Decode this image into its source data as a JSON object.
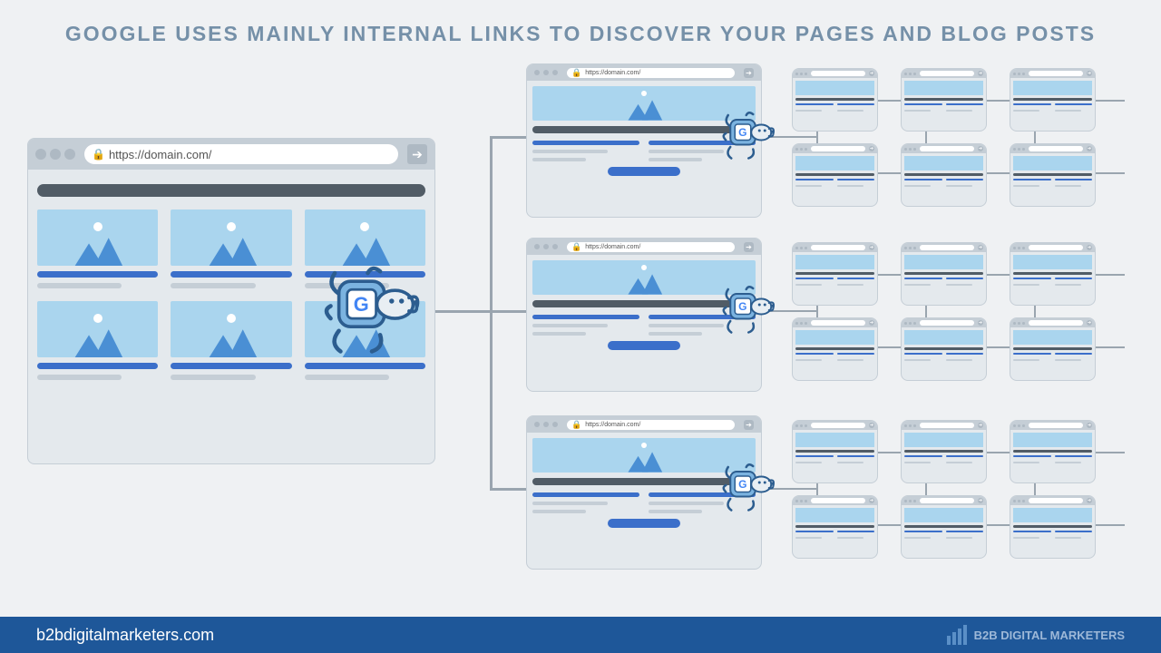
{
  "title": "GOOGLE USES MAINLY INTERNAL LINKS TO DISCOVER YOUR PAGES AND BLOG POSTS",
  "url": "https://domain.com/",
  "footer": {
    "site": "b2bdigitalmarketers.com",
    "brand": "B2B DIGITAL MARKETERS"
  },
  "colors": {
    "accent": "#3b6fca",
    "footer_bg": "#1e5799",
    "page_bg": "#eff1f3"
  }
}
